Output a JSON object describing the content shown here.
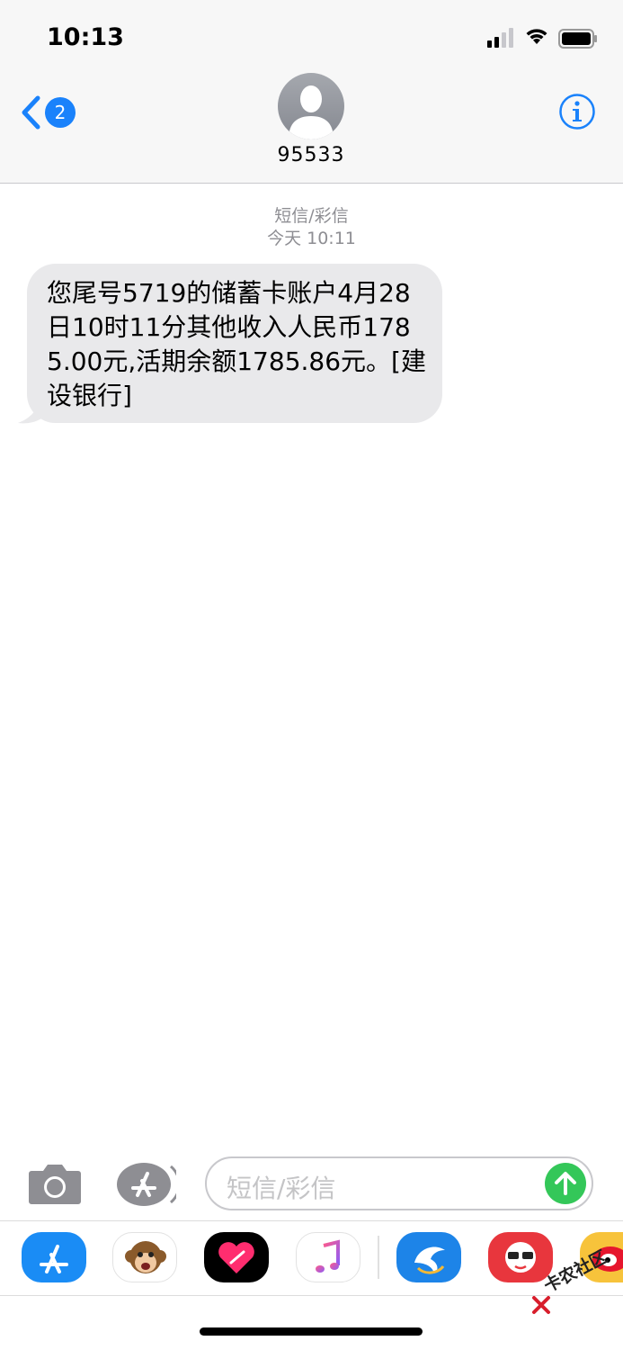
{
  "status_bar": {
    "time": "10:13"
  },
  "nav": {
    "back_badge": "2",
    "contact_name": "95533"
  },
  "conversation": {
    "service_label": "短信/彩信",
    "timestamp": "今天 10:11",
    "messages": [
      {
        "direction": "incoming",
        "text": "您尾号5719的储蓄卡账户4月28日10时11分其他收入人民币1785.00元,活期余额1785.86元。[建设银行]"
      }
    ]
  },
  "composer": {
    "placeholder": "短信/彩信"
  },
  "app_drawer": {
    "apps": [
      "app-store-icon",
      "animoji-monkey-icon",
      "digital-touch-icon",
      "music-icon",
      "dolphin-app-icon",
      "red-3d-glasses-app-icon",
      "weibo-icon"
    ]
  },
  "watermark": {
    "text": "卡农社区"
  },
  "colors": {
    "accent": "#1a82fb",
    "incoming_bubble": "#e9e9eb",
    "send_button": "#34c759",
    "meta_text": "#8e8e93"
  }
}
